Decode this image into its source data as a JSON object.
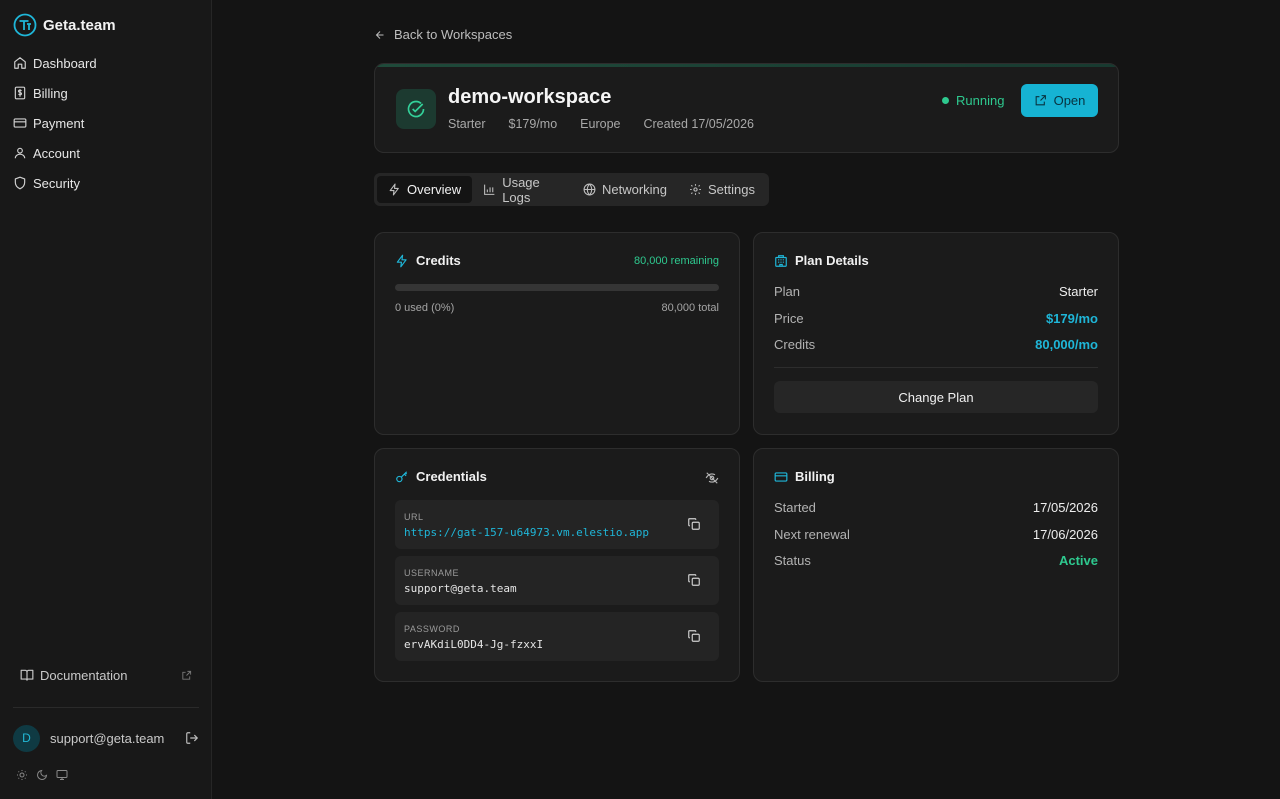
{
  "sidebar": {
    "brand": "Geta.team",
    "items": [
      {
        "label": "Dashboard",
        "icon": "home-icon"
      },
      {
        "label": "Billing",
        "icon": "receipt-icon"
      },
      {
        "label": "Payment",
        "icon": "credit-card-icon"
      },
      {
        "label": "Account",
        "icon": "user-icon"
      },
      {
        "label": "Security",
        "icon": "shield-icon"
      }
    ],
    "documentation": "Documentation",
    "user": {
      "initial": "D",
      "email": "support@geta.team"
    }
  },
  "back_label": "Back to Workspaces",
  "workspace": {
    "name": "demo-workspace",
    "plan": "Starter",
    "price": "$179/mo",
    "region": "Europe",
    "created": "Created 17/05/2026",
    "status": "Running",
    "open_label": "Open"
  },
  "tabs": [
    {
      "label": "Overview",
      "active": true
    },
    {
      "label": "Usage Logs"
    },
    {
      "label": "Networking"
    },
    {
      "label": "Settings"
    }
  ],
  "credits": {
    "title": "Credits",
    "remaining": "80,000 remaining",
    "used": "0 used (0%)",
    "total": "80,000 total",
    "used_fraction": 0
  },
  "plan_details": {
    "title": "Plan Details",
    "rows": [
      {
        "label": "Plan",
        "value": "Starter"
      },
      {
        "label": "Price",
        "value": "$179/mo"
      },
      {
        "label": "Credits",
        "value": "80,000/mo"
      }
    ],
    "change_label": "Change Plan"
  },
  "credentials": {
    "title": "Credentials",
    "fields": [
      {
        "label": "URL",
        "value": "https://gat-157-u64973.vm.elestio.app"
      },
      {
        "label": "USERNAME",
        "value": "support@geta.team"
      },
      {
        "label": "PASSWORD",
        "value": "ervAKdiL0DD4-Jg-fzxxI"
      }
    ]
  },
  "billing": {
    "title": "Billing",
    "rows": [
      {
        "label": "Started",
        "value": "17/05/2026"
      },
      {
        "label": "Next renewal",
        "value": "17/06/2026"
      },
      {
        "label": "Status",
        "value": "Active"
      }
    ]
  },
  "colors": {
    "accent": "#16b3d3",
    "success": "#2ec98f",
    "background": "#141414"
  }
}
